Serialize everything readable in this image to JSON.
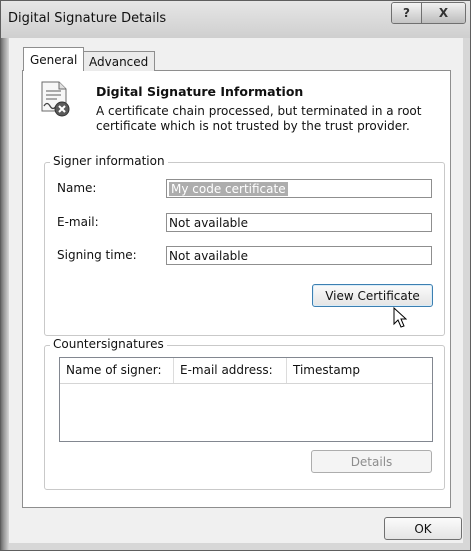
{
  "window": {
    "title": "Digital Signature Details",
    "help_label": "?",
    "close_label": "X"
  },
  "tabs": [
    {
      "label": "General",
      "selected": true
    },
    {
      "label": "Advanced",
      "selected": false
    }
  ],
  "info": {
    "icon": "certificate-error-icon",
    "title": "Digital Signature Information",
    "message": "A certificate chain processed, but terminated in a root certificate which is not trusted by the trust provider."
  },
  "signer": {
    "group_label": "Signer information",
    "name_label": "Name:",
    "name_value": "My code certificate",
    "email_label": "E-mail:",
    "email_value": "Not available",
    "time_label": "Signing time:",
    "time_value": "Not available",
    "view_button": "View Certificate"
  },
  "countersignatures": {
    "group_label": "Countersignatures",
    "columns": [
      "Name of signer:",
      "E-mail address:",
      "Timestamp"
    ],
    "details_button": "Details"
  },
  "footer": {
    "ok_button": "OK"
  }
}
